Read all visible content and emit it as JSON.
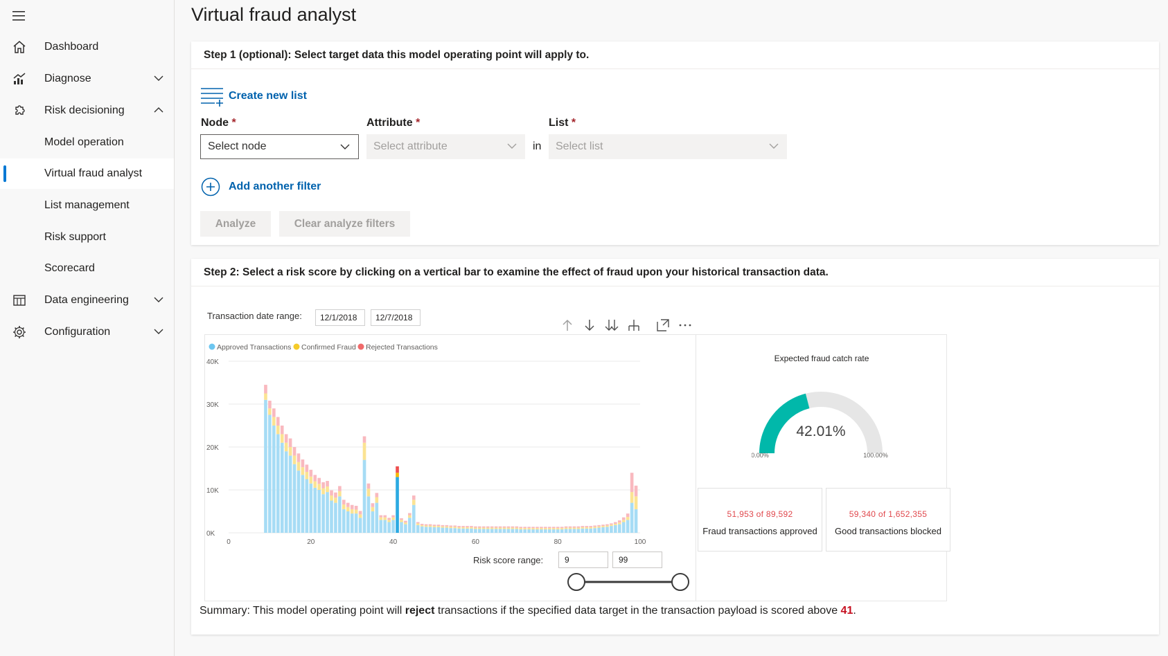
{
  "sidebar": {
    "items": [
      {
        "label": "Dashboard",
        "icon": "home-icon"
      },
      {
        "label": "Diagnose",
        "icon": "chart-icon",
        "expanded": false
      },
      {
        "label": "Risk decisioning",
        "icon": "puzzle-icon",
        "expanded": true
      },
      {
        "label": "Model operation"
      },
      {
        "label": "Virtual fraud analyst",
        "active": true
      },
      {
        "label": "List management"
      },
      {
        "label": "Risk support"
      },
      {
        "label": "Scorecard"
      },
      {
        "label": "Data engineering",
        "icon": "table-icon",
        "expanded": false
      },
      {
        "label": "Configuration",
        "icon": "gear-icon",
        "expanded": false
      }
    ]
  },
  "page": {
    "title": "Virtual fraud analyst"
  },
  "step1": {
    "header": "Step 1 (optional): Select target data this model operating point will apply to.",
    "create_list": "Create new list",
    "node_label": "Node",
    "attribute_label": "Attribute",
    "list_label": "List",
    "required_mark": "*",
    "node_placeholder": "Select node",
    "attribute_placeholder": "Select attribute",
    "in_text": "in",
    "list_placeholder": "Select list",
    "add_filter": "Add another filter",
    "analyze": "Analyze",
    "clear_filters": "Clear analyze filters"
  },
  "step2": {
    "header": "Step 2: Select a risk score by clicking on a vertical bar to examine the effect of fraud upon your historical transaction data.",
    "date_range_label": "Transaction date range:",
    "date_start": "12/1/2018",
    "date_end": "12/7/2018",
    "risk_range_label": "Risk score range:",
    "risk_min": "9",
    "risk_max": "99",
    "slider_range_fraction": [
      0.0,
      1.0
    ]
  },
  "gauge": {
    "title": "Expected fraud catch rate",
    "value": "42.01%",
    "fraction": 0.4201,
    "min_label": "0.00%",
    "max_label": "100.00%",
    "fill_color": "#01b8aa",
    "track_color": "#e6e6e6"
  },
  "kpis": [
    {
      "value": "51,953 of 89,592",
      "label": "Fraud transactions approved"
    },
    {
      "value": "59,340 of 1,652,355",
      "label": "Good transactions blocked"
    }
  ],
  "summary": {
    "prefix": "Summary: This model operating point will ",
    "bold": "reject",
    "middle": " transactions if the specified data target in the transaction payload is scored above ",
    "threshold": "41",
    "suffix": "."
  },
  "chart_data": {
    "type": "bar",
    "stacked": true,
    "legend": [
      "Approved Transactions",
      "Confirmed Fraud",
      "Rejected Transactions"
    ],
    "legend_position": "top-left",
    "colors": {
      "approved": "#a6dcf5",
      "fraud": "#fbe393",
      "rejected": "#f9b9bf",
      "selected": "#2caae2"
    },
    "x_ticks": [
      "0",
      "20",
      "40",
      "60",
      "80",
      "100"
    ],
    "y_ticks": [
      "0K",
      "10K",
      "20K",
      "30K",
      "40K"
    ],
    "xlim": [
      0,
      100
    ],
    "ylim": [
      0,
      40000
    ],
    "selected_score": 41,
    "x": [
      9,
      10,
      11,
      12,
      13,
      14,
      15,
      16,
      17,
      18,
      19,
      20,
      21,
      22,
      23,
      24,
      25,
      26,
      27,
      28,
      29,
      30,
      31,
      32,
      33,
      34,
      35,
      36,
      37,
      38,
      39,
      40,
      41,
      42,
      43,
      44,
      45,
      46,
      47,
      48,
      49,
      50,
      51,
      52,
      53,
      54,
      55,
      56,
      57,
      58,
      59,
      60,
      61,
      62,
      63,
      64,
      65,
      66,
      67,
      68,
      69,
      70,
      71,
      72,
      73,
      74,
      75,
      76,
      77,
      78,
      79,
      80,
      81,
      82,
      83,
      84,
      85,
      86,
      87,
      88,
      89,
      90,
      91,
      92,
      93,
      94,
      95,
      96,
      97,
      98,
      99
    ],
    "series": [
      {
        "name": "Approved Transactions",
        "values": [
          31000,
          27500,
          25000,
          23000,
          21000,
          19000,
          18000,
          16000,
          14500,
          13500,
          12500,
          11500,
          10500,
          10000,
          9000,
          9500,
          7500,
          7000,
          8500,
          5500,
          5000,
          4500,
          4500,
          3500,
          17000,
          8500,
          5000,
          7000,
          3000,
          3000,
          2500,
          3000,
          13000,
          2500,
          2000,
          3500,
          6500,
          1800,
          1500,
          1400,
          1400,
          1300,
          1300,
          1200,
          1200,
          1100,
          1100,
          1000,
          1000,
          1000,
          1000,
          900,
          900,
          900,
          900,
          900,
          900,
          900,
          900,
          900,
          900,
          900,
          800,
          800,
          800,
          800,
          800,
          800,
          800,
          800,
          800,
          800,
          800,
          900,
          900,
          900,
          900,
          1000,
          1000,
          1000,
          1100,
          1200,
          1300,
          1400,
          1600,
          1800,
          2000,
          2500,
          3000,
          7000,
          5500
        ]
      },
      {
        "name": "Confirmed Fraud",
        "values": [
          1500,
          1500,
          2000,
          2000,
          2000,
          2000,
          2000,
          2000,
          2000,
          1800,
          1700,
          1600,
          1500,
          1400,
          1400,
          1300,
          1200,
          1200,
          1200,
          1100,
          1000,
          1000,
          900,
          800,
          4000,
          1800,
          1000,
          1300,
          600,
          600,
          500,
          600,
          1000,
          500,
          400,
          600,
          1200,
          400,
          300,
          300,
          300,
          300,
          300,
          300,
          300,
          300,
          300,
          300,
          300,
          300,
          300,
          300,
          300,
          300,
          300,
          300,
          300,
          300,
          300,
          300,
          300,
          300,
          300,
          300,
          300,
          300,
          300,
          300,
          300,
          300,
          300,
          300,
          300,
          300,
          300,
          300,
          300,
          300,
          300,
          300,
          300,
          300,
          300,
          300,
          300,
          300,
          400,
          500,
          700,
          2500,
          3000
        ]
      },
      {
        "name": "Rejected Transactions",
        "values": [
          2000,
          1800,
          2000,
          2000,
          2000,
          2000,
          2000,
          2000,
          2000,
          1800,
          1700,
          1600,
          1500,
          1400,
          1400,
          1300,
          1200,
          1200,
          1200,
          1100,
          1000,
          1000,
          900,
          800,
          1500,
          1200,
          900,
          1000,
          500,
          500,
          500,
          500,
          1500,
          400,
          400,
          500,
          1000,
          300,
          300,
          300,
          300,
          300,
          300,
          300,
          300,
          300,
          300,
          300,
          300,
          300,
          300,
          300,
          300,
          300,
          300,
          300,
          300,
          300,
          300,
          300,
          300,
          300,
          300,
          300,
          300,
          300,
          300,
          300,
          300,
          300,
          300,
          300,
          300,
          300,
          300,
          300,
          300,
          300,
          300,
          300,
          300,
          300,
          300,
          300,
          300,
          400,
          500,
          600,
          800,
          4500,
          2500
        ]
      }
    ]
  }
}
